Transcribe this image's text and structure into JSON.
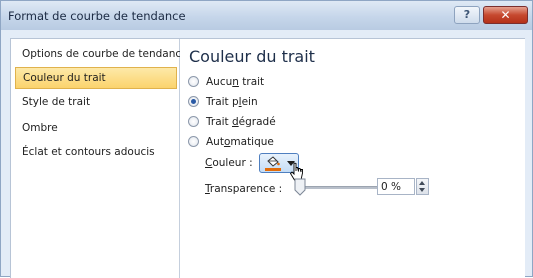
{
  "window": {
    "title": "Format de courbe de tendance",
    "help_label": "?",
    "close_label": "✕"
  },
  "nav": {
    "items": [
      {
        "label": "Options de courbe de tendance",
        "selected": false
      },
      {
        "label": "Couleur du trait",
        "selected": true
      },
      {
        "label": "Style de trait",
        "selected": false
      },
      {
        "label": "Ombre",
        "selected": false
      },
      {
        "label": "Éclat et contours adoucis",
        "selected": false
      }
    ]
  },
  "pane": {
    "heading": "Couleur du trait",
    "options": [
      {
        "pre": "Aucu",
        "key": "n",
        "post": " trait",
        "checked": false
      },
      {
        "pre": "Trait p",
        "key": "l",
        "post": "ein",
        "checked": true
      },
      {
        "pre": "Trait ",
        "key": "d",
        "post": "égradé",
        "checked": false
      },
      {
        "pre": "Aut",
        "key": "o",
        "post": "matique",
        "checked": false
      }
    ],
    "color": {
      "label_key": "C",
      "label_rest": "ouleur :",
      "swatch_color": "#e36c09",
      "button_icon": "paint-bucket-icon"
    },
    "transparency": {
      "label_key": "T",
      "label_rest": "ransparence :",
      "value": "0 %",
      "slider_fraction": 0
    }
  },
  "colors": {
    "accent_selected": "#fbd36d",
    "titlebar": "#c6d6ea",
    "close": "#c6482f"
  }
}
